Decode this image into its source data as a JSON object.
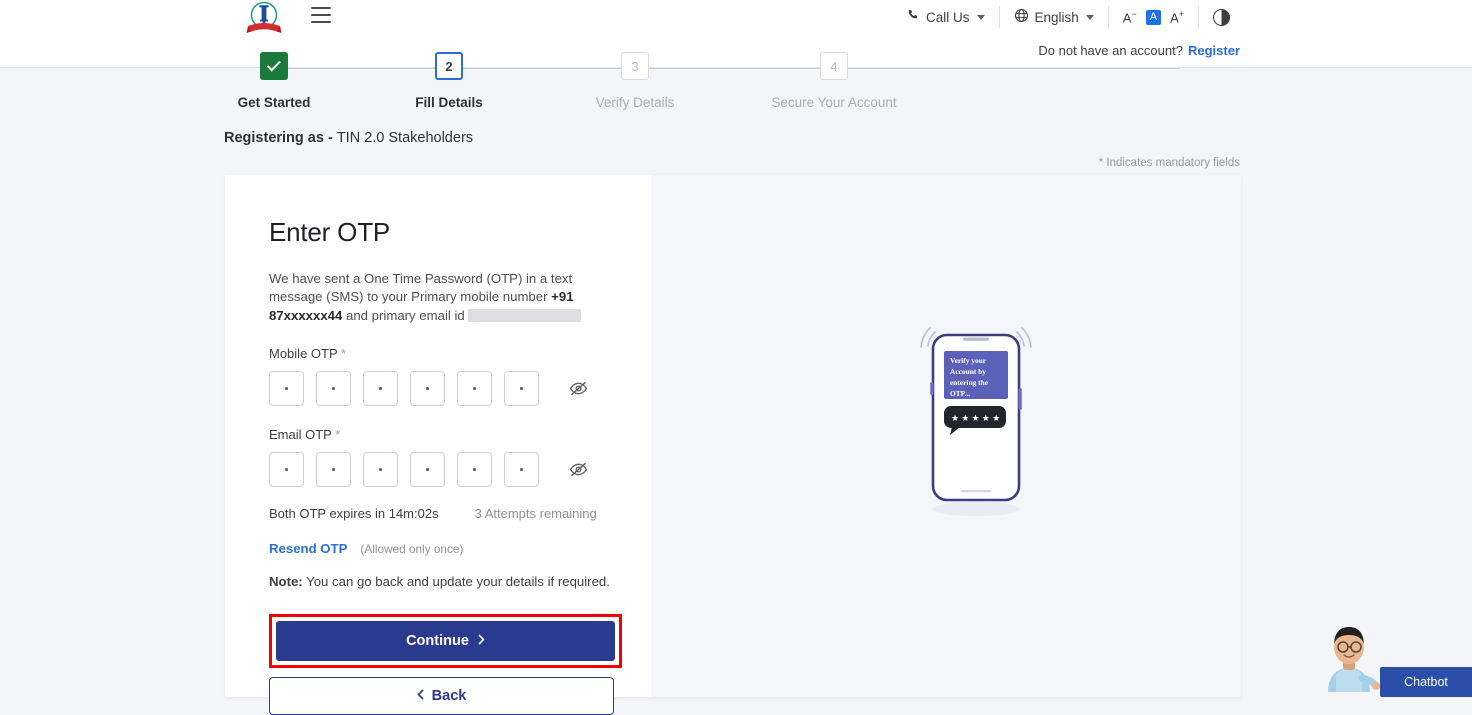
{
  "header": {
    "logo_alt": "Income Tax Department emblem",
    "menu_icon": "hamburger-icon",
    "call_us": "Call Us",
    "language": "English",
    "font_decrease": "A",
    "font_normal": "A",
    "font_increase": "A",
    "contrast_icon": "contrast-icon",
    "account_prompt": "Do not have an account?",
    "register_link": "Register"
  },
  "stepper": {
    "steps": [
      {
        "num": "1",
        "label": "Get Started",
        "state": "done"
      },
      {
        "num": "2",
        "label": "Fill Details",
        "state": "current"
      },
      {
        "num": "3",
        "label": "Verify Details",
        "state": "todo"
      },
      {
        "num": "4",
        "label": "Secure Your Account",
        "state": "todo"
      }
    ]
  },
  "page": {
    "registering_as_prefix": "Registering as - ",
    "registering_as_value": "TIN 2.0 Stakeholders",
    "mandatory_note": "* Indicates mandatory fields"
  },
  "otp": {
    "title": "Enter OTP",
    "desc_part1": "We have sent a One Time Password (OTP) in a text message (SMS) to your Primary mobile number ",
    "mobile_number": "+91 87xxxxxx44",
    "desc_part2": " and primary email id ",
    "mobile_label": "Mobile OTP ",
    "email_label": "Email OTP ",
    "required_star": "*",
    "mobile_digits": [
      "•",
      "•",
      "•",
      "•",
      "•",
      "•"
    ],
    "email_digits": [
      "•",
      "•",
      "•",
      "•",
      "•",
      "•"
    ],
    "toggle_icon": "eye-off-icon",
    "expiry_text": "Both OTP expires in 14m:02s",
    "attempts_text": "3 Attempts remaining",
    "resend_label": "Resend OTP",
    "resend_note": "(Allowed only once)",
    "note_bold": "Note:",
    "note_text": " You can go back and update your details if required.",
    "continue_label": "Continue",
    "continue_icon": "chevron-right-icon",
    "back_label": "Back",
    "back_icon": "chevron-left-icon"
  },
  "illustration": {
    "name": "phone-otp-illustration",
    "screen_text": "Verify your Account by entering the OTP...",
    "bubble_text": "✱✱✱✱✱"
  },
  "chatbot": {
    "label": "Chatbot",
    "avatar_icon": "chatbot-avatar-icon"
  },
  "colors": {
    "primary": "#2a3a8f",
    "link": "#2a6fd6",
    "success": "#1a7a3c",
    "highlight": "#f40000",
    "page_bg": "#f4f5f8"
  }
}
